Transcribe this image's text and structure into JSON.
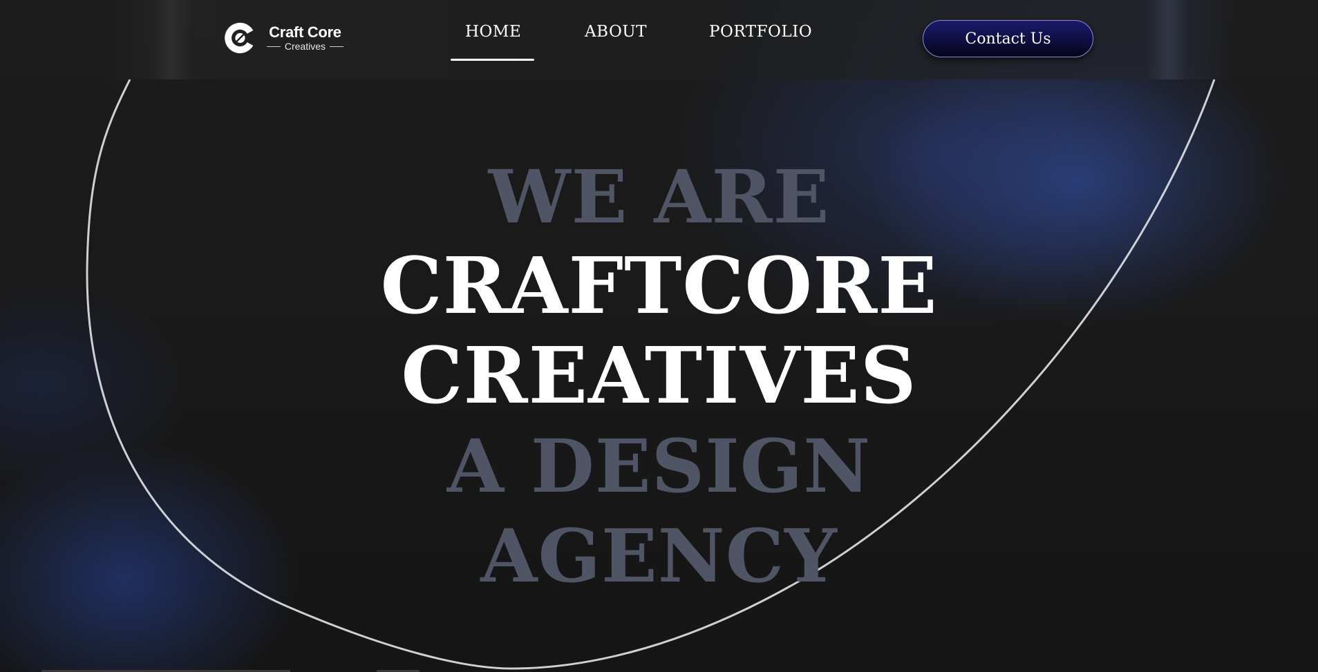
{
  "brand": {
    "name": "Craft Core",
    "tagline": "Creatives",
    "logo_icon": "cc-monogram-icon"
  },
  "nav": {
    "items": [
      {
        "label": "HOME",
        "active": true
      },
      {
        "label": "ABOUT",
        "active": false
      },
      {
        "label": "PORTFOLIO",
        "active": false
      }
    ]
  },
  "header": {
    "contact_label": "Contact Us"
  },
  "hero": {
    "line1": "WE ARE",
    "line2": "CRAFTCORE",
    "line3": "CREATIVES",
    "line4": "A DESIGN",
    "line5": "AGENCY"
  },
  "colors": {
    "background": "#1c1c1c",
    "accent_blue": "#2e4894",
    "button_navy": "#10104a",
    "dim_text": "#4f5564",
    "outline": "#cfcfd6"
  }
}
